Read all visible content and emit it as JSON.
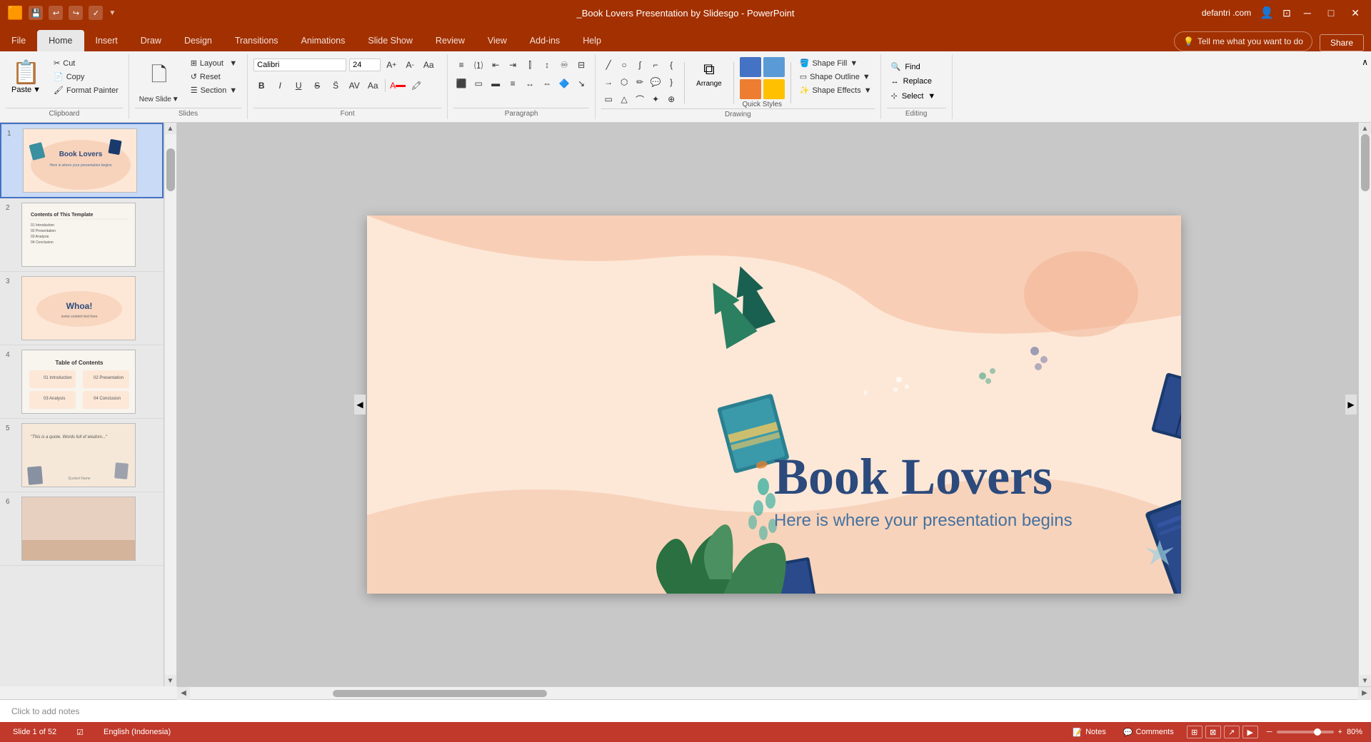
{
  "app": {
    "title": "_Book Lovers Presentation by Slidesgo - PowerPoint",
    "user": "defantri .com"
  },
  "titlebar": {
    "save_icon": "💾",
    "undo_icon": "↩",
    "redo_icon": "↪",
    "accessibility_icon": "✓",
    "dropdown_icon": "▼",
    "minimize": "─",
    "maximize": "□",
    "close": "✕"
  },
  "tabs": [
    {
      "label": "File",
      "active": false
    },
    {
      "label": "Home",
      "active": true
    },
    {
      "label": "Insert",
      "active": false
    },
    {
      "label": "Draw",
      "active": false
    },
    {
      "label": "Design",
      "active": false
    },
    {
      "label": "Transitions",
      "active": false
    },
    {
      "label": "Animations",
      "active": false
    },
    {
      "label": "Slide Show",
      "active": false
    },
    {
      "label": "Review",
      "active": false
    },
    {
      "label": "View",
      "active": false
    },
    {
      "label": "Add-ins",
      "active": false
    },
    {
      "label": "Help",
      "active": false
    }
  ],
  "tell_me": "Tell me what you want to do",
  "share_label": "Share",
  "ribbon": {
    "clipboard": {
      "paste_label": "Paste",
      "cut_label": "Cut",
      "copy_label": "Copy",
      "format_painter_label": "Format Painter",
      "group_label": "Clipboard"
    },
    "slides": {
      "new_slide_label": "New Slide",
      "layout_label": "Layout",
      "reset_label": "Reset",
      "section_label": "Section",
      "group_label": "Slides"
    },
    "font": {
      "family": "Calibri",
      "size": "24",
      "bold": "B",
      "italic": "I",
      "underline": "U",
      "strikethrough": "S",
      "increase_size": "A",
      "decrease_size": "A",
      "group_label": "Font"
    },
    "paragraph": {
      "group_label": "Paragraph"
    },
    "drawing": {
      "arrange_label": "Arrange",
      "quick_styles_label": "Quick Styles",
      "shape_fill_label": "Shape Fill",
      "shape_outline_label": "Shape Outline",
      "shape_effects_label": "Shape Effects",
      "group_label": "Drawing"
    },
    "editing": {
      "find_label": "Find",
      "replace_label": "Replace",
      "select_label": "Select",
      "group_label": "Editing"
    }
  },
  "slides": [
    {
      "number": "1",
      "active": true
    },
    {
      "number": "2",
      "active": false
    },
    {
      "number": "3",
      "active": false
    },
    {
      "number": "4",
      "active": false
    },
    {
      "number": "5",
      "active": false
    },
    {
      "number": "6",
      "active": false
    }
  ],
  "slide_content": {
    "title": "Book Lovers",
    "subtitle": "Here is where your presentation begins"
  },
  "notes": {
    "placeholder": "Click to add notes",
    "label": "Notes"
  },
  "status": {
    "slide_info": "Slide 1 of 52",
    "language": "English (Indonesia)",
    "zoom": "80%",
    "notes_label": "Notes",
    "comments_label": "Comments"
  },
  "colors": {
    "accent": "#c0392b",
    "tab_active_bg": "#e8e8e8",
    "slide_bg": "#fde8d8",
    "title_color": "#2c4a7c",
    "subtitle_color": "#4472a0",
    "teal_book": "#3a8fa0",
    "dark_blue": "#1a3a6c"
  }
}
